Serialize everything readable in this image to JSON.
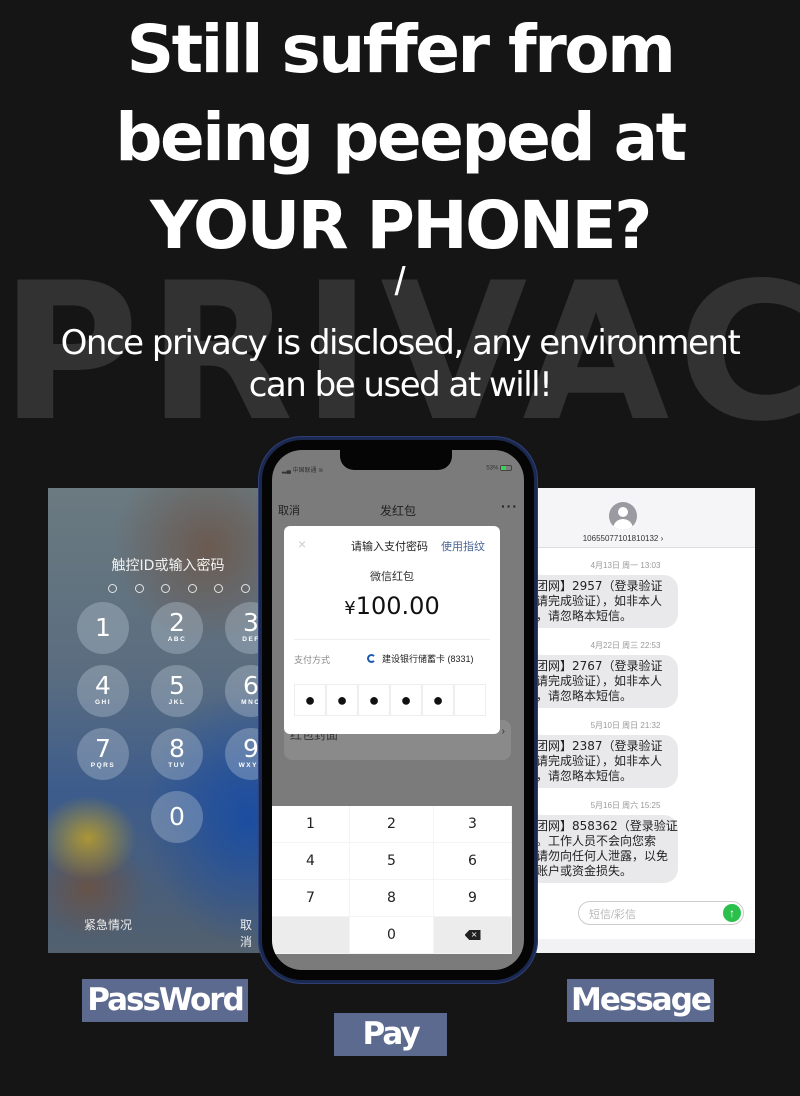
{
  "headline": {
    "lines": [
      "Still suffer from",
      "being peeped at",
      "YOUR PHONE?"
    ],
    "watermark": "PRIVACY",
    "separator": "/",
    "sub_lines": [
      "Once privacy is disclosed, any environment",
      "can be used at will!"
    ]
  },
  "lockscreen": {
    "title": "触控ID或输入密码",
    "passcode_length": 6,
    "keys": [
      {
        "n": "1",
        "l": ""
      },
      {
        "n": "2",
        "l": "ABC"
      },
      {
        "n": "3",
        "l": "DEF"
      },
      {
        "n": "4",
        "l": "GHI"
      },
      {
        "n": "5",
        "l": "JKL"
      },
      {
        "n": "6",
        "l": "MNO"
      },
      {
        "n": "7",
        "l": "PQRS"
      },
      {
        "n": "8",
        "l": "TUV"
      },
      {
        "n": "9",
        "l": "WXYZ"
      },
      {
        "n": "0",
        "l": ""
      }
    ],
    "emergency": "紧急情况",
    "cancel": "取消"
  },
  "pay": {
    "status_left": "中国联通",
    "status_right": "53%",
    "battery_percent": 53,
    "nav_cancel": "取消",
    "nav_title": "发红包",
    "nav_more": "···",
    "modal": {
      "close": "×",
      "title": "请输入支付密码",
      "fingerprint": "使用指纹",
      "subtitle": "微信红包",
      "currency": "¥",
      "amount": "100.00",
      "method_label": "支付方式",
      "method_value": "建设银行储蓄卡 (8331)",
      "pin_filled": 5,
      "pin_length": 6
    },
    "behind_label": "红包封面",
    "behind_arrow": "›",
    "keypad": [
      "1",
      "2",
      "3",
      "4",
      "5",
      "6",
      "7",
      "8",
      "9",
      "",
      "0",
      "⌫"
    ]
  },
  "messages": {
    "sender": "10655077101810132 ›",
    "items": [
      {
        "time": "4月13日 周一 13:03",
        "text": "团网】2957（登录验证\n请完成验证），如非本人\n，请忽略本短信。"
      },
      {
        "time": "4月22日 周三 22:53",
        "text": "团网】2767（登录验证\n请完成验证），如非本人\n，请忽略本短信。"
      },
      {
        "time": "5月10日 周日 21:32",
        "text": "团网】2387（登录验证\n请完成验证），如非本人\n，请忽略本短信。"
      },
      {
        "time": "5月16日 周六 15:25",
        "text": "团网】858362（登录验证\n。工作人员不会向您索\n请勿向任何人泄露，以免\n账户或资金损失。"
      }
    ],
    "input_placeholder": "短信/彩信",
    "send_icon": "↑"
  },
  "labels": {
    "password": "PassWord",
    "pay": "Pay",
    "message": "Message"
  },
  "colors": {
    "background": "#151515",
    "label_bg": "#5c6a8f",
    "link_blue": "#4a6694",
    "send_green": "#2bc04c"
  }
}
